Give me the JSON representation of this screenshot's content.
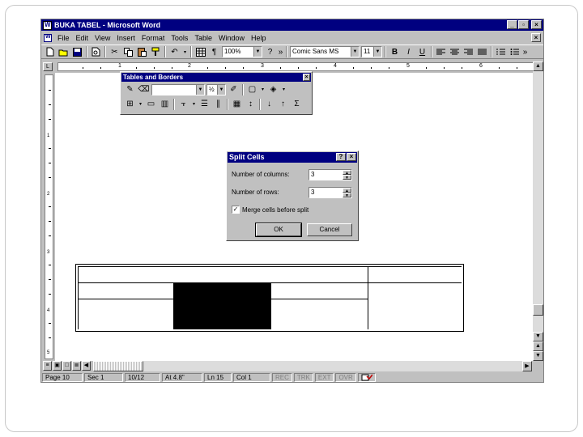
{
  "window": {
    "title": "BUKA TABEL - Microsoft Word",
    "controls": [
      "_",
      "▫",
      "×"
    ]
  },
  "menu": {
    "items": [
      "File",
      "Edit",
      "View",
      "Insert",
      "Format",
      "Tools",
      "Table",
      "Window",
      "Help"
    ],
    "doc_close": "×"
  },
  "toolbar": {
    "zoom": "100%",
    "font": "Comic Sans MS",
    "size": "11",
    "bold": "B",
    "italic": "I",
    "underline": "U",
    "more": "»"
  },
  "ruler": {
    "numbers": [
      "1",
      "2",
      "3",
      "4",
      "5",
      "6"
    ],
    "vnumbers": [
      "1",
      "2",
      "3",
      "4",
      "5"
    ]
  },
  "tables_toolbar": {
    "title": "Tables and Borders",
    "line_weight": "½",
    "close": "×"
  },
  "dialog": {
    "title": "Split Cells",
    "help": "?",
    "close": "×",
    "columns_label": "Number of columns:",
    "columns_value": "3",
    "rows_label": "Number of rows:",
    "rows_value": "3",
    "merge_label": "Merge cells before split",
    "merge_checked": "✓",
    "ok": "OK",
    "cancel": "Cancel"
  },
  "status": {
    "page": "Page 10",
    "sec": "Sec 1",
    "pages": "10/12",
    "at": "At 4.8\"",
    "ln": "Ln 15",
    "col": "Col 1",
    "rec": "REC",
    "trk": "TRK",
    "ext": "EXT",
    "ovr": "OVR"
  }
}
